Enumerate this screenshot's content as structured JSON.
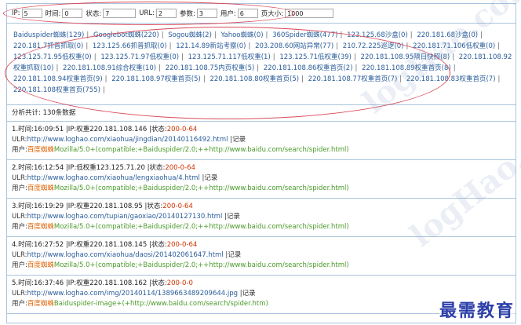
{
  "filters": [
    {
      "label": "IP:",
      "value": "5"
    },
    {
      "label": "时间:",
      "value": "0"
    },
    {
      "label": "状态:",
      "value": "7"
    },
    {
      "label": "URL:",
      "value": "2"
    },
    {
      "label": "参数:",
      "value": "3"
    },
    {
      "label": "用户:",
      "value": "6"
    },
    {
      "label": "页大小:",
      "value": "1000"
    }
  ],
  "spiders": [
    "Baiduspider蜘蛛(129)",
    "Googlebot蜘蛛(220)",
    "Sogou蜘蛛(2)",
    "Yahoo蜘蛛(0)",
    "360Spider蜘蛛(477)",
    "123.125.68沙盒(0)",
    "220.181.68沙盒(0)",
    "220.181.7抓普抓取(0)",
    "123.125.66抓普抓取(0)",
    "121.14.89新站考察(0)",
    "203.208.60网站异常(77)",
    "210.72.225巡逻(0)",
    "220.181.71.106低权重(0)",
    "123.125.71.95低权重(0)",
    "123.125.71.97低权重(0)",
    "123.125.71.117低权重(1)",
    "123.125.71低权重(39)",
    "220.181.108.95隔日快照(8)",
    "220.181.108.92权重抓取(10)",
    "220.181.108.91综合权重(10)",
    "220.181.108.75内页权重(5)",
    "220.181.108.86权重首页(2)",
    "220.181.108.89权重首页(8)",
    "220.181.108.94权重首页(9)",
    "220.181.108.97权重首页(5)",
    "220.181.108.80权重首页(5)",
    "220.181.108.77权重首页(7)",
    "220.181.108.83权重首页(7)",
    "220.181.108权重首页(755)"
  ],
  "summary": "分析共计: 130条数据",
  "records": [
    {
      "title": "1.时间:",
      "time": "16:09:51",
      "ip": "|IP:权重220.181.108.146",
      "status_label": "|状态:",
      "status": "200-0-64",
      "url_label": "ULR:",
      "url": "http://www.loghao.com/xiaohua/jingdian/20140116492.html",
      "record_label": "|记录",
      "ua_label": "用户:",
      "ua_hl": "百度蜘蛛",
      "ua": "Mozilla/5.0+(compatible;+Baiduspider/2.0;++http://www.baidu.com/search/spider.html)"
    },
    {
      "title": "2.时间:",
      "time": "16:12:54",
      "ip": "|IP:低权重123.125.71.20",
      "status_label": "|状态:",
      "status": "200-0-64",
      "url_label": "ULR:",
      "url": "http://www.loghao.com/xiaohua/lengxiaohua/4.html",
      "record_label": "|记录",
      "ua_label": "用户:",
      "ua_hl": "百度蜘蛛",
      "ua": "Mozilla/5.0+(compatible;+Baiduspider/2.0;++http://www.baidu.com/search/spider.html)"
    },
    {
      "title": "3.时间:",
      "time": "16:19:29",
      "ip": "|IP:权重220.181.108.95",
      "status_label": "|状态:",
      "status": "200-0-64",
      "url_label": "ULR:",
      "url": "http://www.loghao.com/tupian/gaoxiao/20140127130.html",
      "record_label": "|记录",
      "ua_label": "用户:",
      "ua_hl": "百度蜘蛛",
      "ua": "Mozilla/5.0+(compatible;+Baiduspider/2.0;++http://www.baidu.com/search/spider.html)"
    },
    {
      "title": "4.时间:",
      "time": "16:27:52",
      "ip": "|IP:权重220.181.108.145",
      "status_label": "|状态:",
      "status": "200-0-64",
      "url_label": "ULR:",
      "url": "http://www.loghao.com/xiaohua/daosi/201402061647.html",
      "record_label": "|记录",
      "ua_label": "用户:",
      "ua_hl": "百度蜘蛛",
      "ua": "Mozilla/5.0+(compatible;+Baiduspider/2.0;++http://www.baidu.com/search/spider.html)"
    },
    {
      "title": "5.时间:",
      "time": "16:37:46",
      "ip": "|IP:权重220.181.108.162",
      "status_label": "|状态:",
      "status": "200-0-0",
      "url_label": "ULR:",
      "url": "http://www.loghao.com/img/20140114/1389663489209644.jpg",
      "record_label": "|记录",
      "ua_label": "用户:",
      "ua_hl": "百度蜘蛛",
      "ua": "Baiduspider-image+(+http://www.baidu.com/search/spider.htm)"
    }
  ],
  "watermark": "logHao.com",
  "brand": "最需教育",
  "colors": {
    "annotation": "#d84a5a",
    "link": "#2a5c9a",
    "status": "#cc3300",
    "agent": "#4a9a2a",
    "brand": "#2b3fa8"
  }
}
